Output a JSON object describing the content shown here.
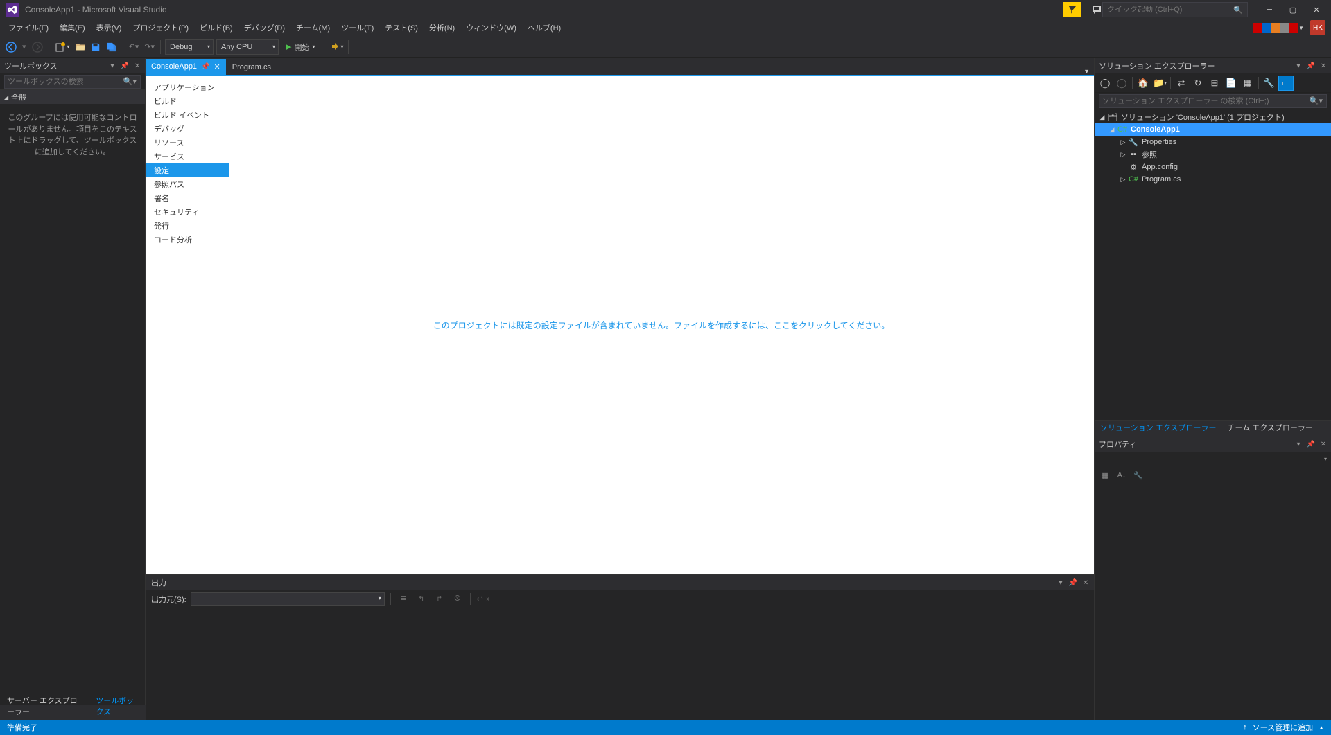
{
  "titlebar": {
    "title": "ConsoleApp1 - Microsoft Visual Studio",
    "quick_launch_placeholder": "クイック起動 (Ctrl+Q)"
  },
  "menubar": {
    "items": [
      "ファイル(F)",
      "編集(E)",
      "表示(V)",
      "プロジェクト(P)",
      "ビルド(B)",
      "デバッグ(D)",
      "チーム(M)",
      "ツール(T)",
      "テスト(S)",
      "分析(N)",
      "ウィンドウ(W)",
      "ヘルプ(H)"
    ],
    "avatar": "HK"
  },
  "toolbar": {
    "config": "Debug",
    "platform": "Any CPU",
    "start": "開始"
  },
  "toolbox": {
    "title": "ツールボックス",
    "search_placeholder": "ツールボックスの検索",
    "group": "全般",
    "empty_msg": "このグループには使用可能なコントロールがありません。項目をこのテキスト上にドラッグして、ツールボックスに追加してください。"
  },
  "left_tabs": {
    "server": "サーバー エクスプローラー",
    "toolbox": "ツールボックス"
  },
  "tabs": {
    "active": "ConsoleApp1",
    "inactive": "Program.cs"
  },
  "settings_nav": [
    "アプリケーション",
    "ビルド",
    "ビルド イベント",
    "デバッグ",
    "リソース",
    "サービス",
    "設定",
    "参照パス",
    "署名",
    "セキュリティ",
    "発行",
    "コード分析"
  ],
  "settings_selected_index": 6,
  "settings_msg": "このプロジェクトには既定の設定ファイルが含まれていません。ファイルを作成するには、ここをクリックしてください。",
  "output": {
    "title": "出力",
    "source_label": "出力元(S):"
  },
  "solution_explorer": {
    "title": "ソリューション エクスプローラー",
    "search_placeholder": "ソリューション エクスプローラー の検索 (Ctrl+;)",
    "solution": "ソリューション 'ConsoleApp1' (1 プロジェクト)",
    "project": "ConsoleApp1",
    "nodes": {
      "properties": "Properties",
      "references": "参照",
      "appconfig": "App.config",
      "program": "Program.cs"
    }
  },
  "right_tabs": {
    "solution": "ソリューション エクスプローラー",
    "team": "チーム エクスプローラー"
  },
  "properties": {
    "title": "プロパティ"
  },
  "statusbar": {
    "ready": "準備完了",
    "source_control": "ソース管理に追加"
  }
}
